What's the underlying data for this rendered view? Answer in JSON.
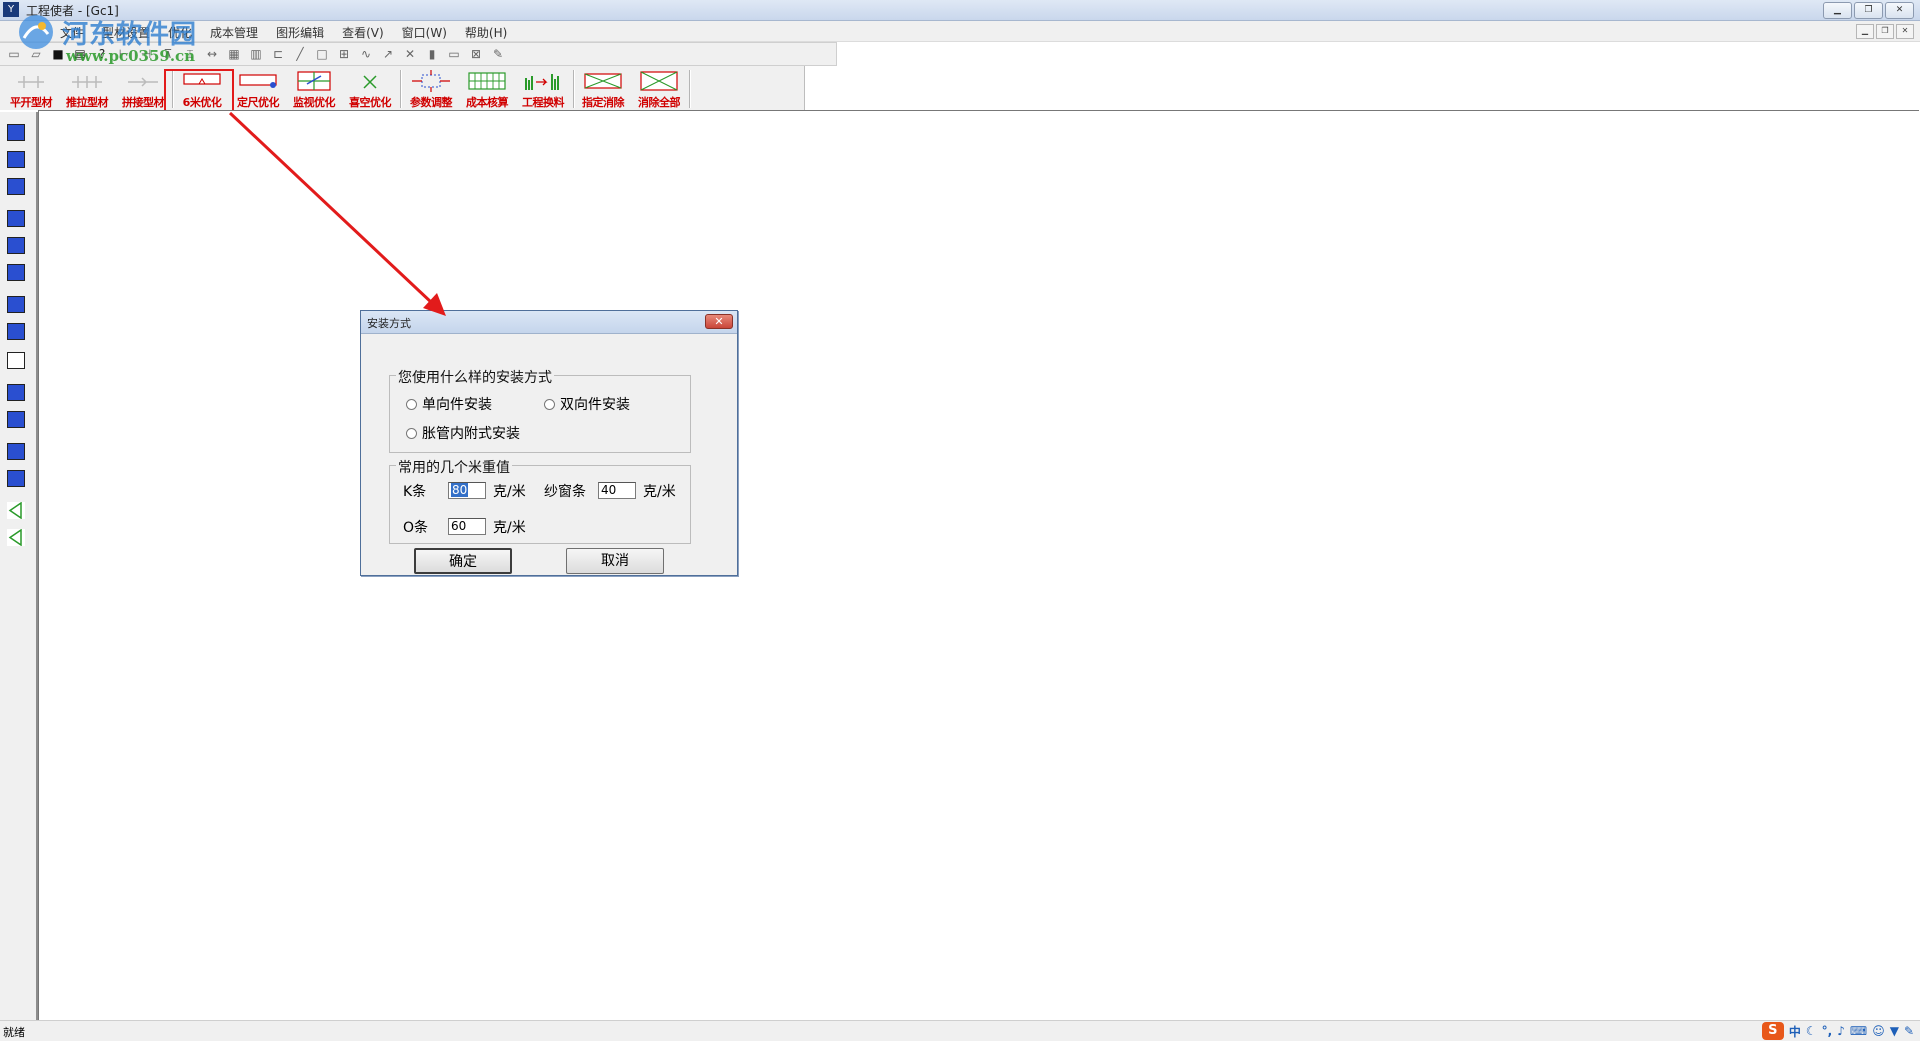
{
  "window": {
    "title": "工程使者 - [Gc1]",
    "app_icon_glyph": "Y"
  },
  "menu": {
    "items": [
      "文件",
      "型材设置",
      "优化",
      "成本管理",
      "图形编辑",
      "查看(V)",
      "窗口(W)",
      "帮助(H)"
    ]
  },
  "watermark": {
    "name": "河东软件园",
    "url": "www.pc0359.cn"
  },
  "toolbar_optimize": {
    "buttons": [
      "平开型材",
      "推拉型材",
      "拼接型材",
      "6米优化",
      "定尺优化",
      "监视优化",
      "喜空优化",
      "参数调整",
      "成本核算",
      "工程换料",
      "指定消除",
      "消除全部"
    ],
    "highlighted": "6米优化"
  },
  "status": {
    "text": "就绪"
  },
  "ime": {
    "logo": "S",
    "lang": "中"
  },
  "dialog": {
    "title": "安装方式",
    "close_glyph": "✕",
    "install_group": {
      "legend": "您使用什么样的安装方式",
      "options": [
        "单向件安装",
        "双向件安装",
        "胀管内附式安装"
      ]
    },
    "weight_group": {
      "legend": "常用的几个米重值",
      "k_label": "K条",
      "k_value": "80",
      "screen_label": "纱窗条",
      "screen_value": "40",
      "o_label": "O条",
      "o_value": "60",
      "unit": "克/米"
    },
    "ok_label": "确定",
    "cancel_label": "取消"
  },
  "colors": {
    "highlight": "#e21b1b",
    "toolbar_label": "#d00000",
    "icon_blue": "#2a4fd0"
  }
}
